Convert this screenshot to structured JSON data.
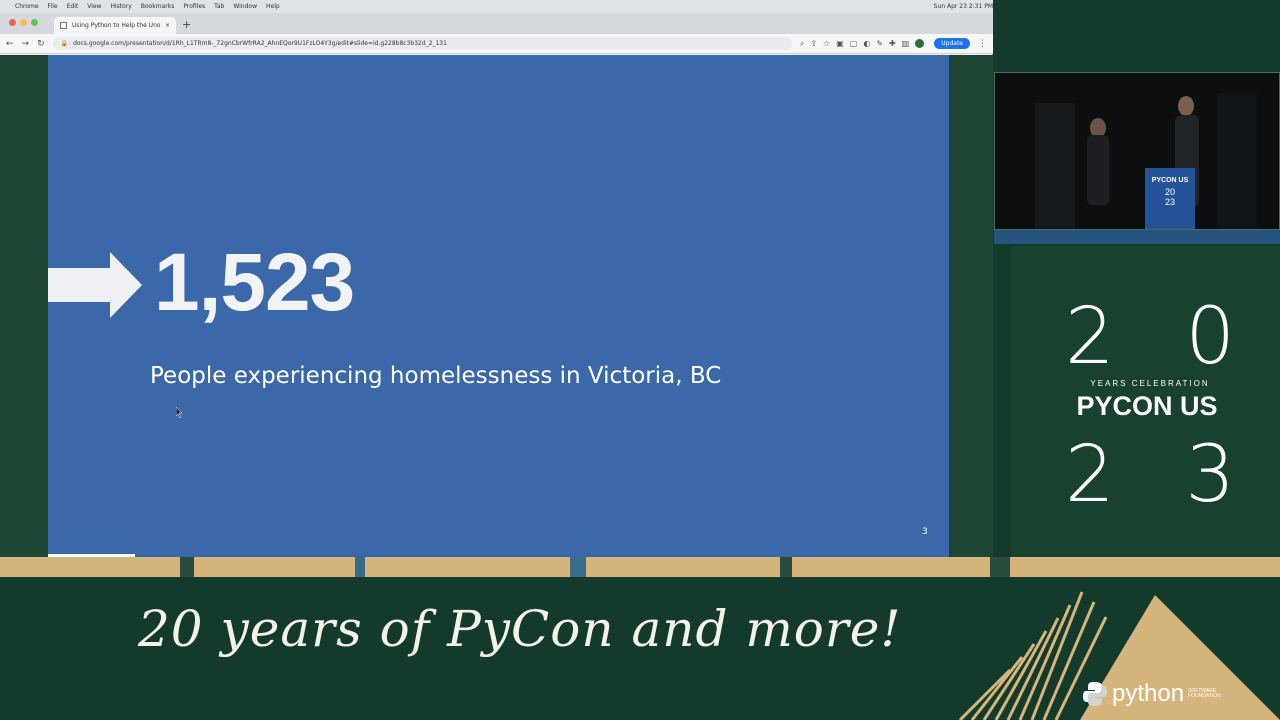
{
  "mac_menubar": {
    "app": "Chrome",
    "items": [
      "File",
      "Edit",
      "View",
      "History",
      "Bookmarks",
      "Profiles",
      "Tab",
      "Window",
      "Help"
    ],
    "clock": "Sun Apr 23 2:31 PM"
  },
  "browser": {
    "tab_title": "Using Python to Help the Uno...",
    "url": "docs.google.com/presentation/d/1Rh_L1TRm8-_72gnCbrWfrRA2_AhnEQor9U1FzLO4Y3g/edit#slide=id.g228b8c3b32d_2_131",
    "update_label": "Update"
  },
  "slide": {
    "number": "1,523",
    "caption": "People experiencing homelessness in Victoria, BC",
    "page": "3",
    "bg_color": "#3b68a8"
  },
  "video": {
    "podium_line1": "PYCON US",
    "podium_line2": "20",
    "podium_line3": "23"
  },
  "logo": {
    "top_digits": [
      "2",
      "0"
    ],
    "subtitle": "YEARS CELEBRATION",
    "main": "PYCON US",
    "bottom_digits": [
      "2",
      "3"
    ]
  },
  "footer": {
    "tagline": "20 years of PyCon and more!",
    "psf_word": "python",
    "psf_small": "SOFTWARE FOUNDATION"
  }
}
